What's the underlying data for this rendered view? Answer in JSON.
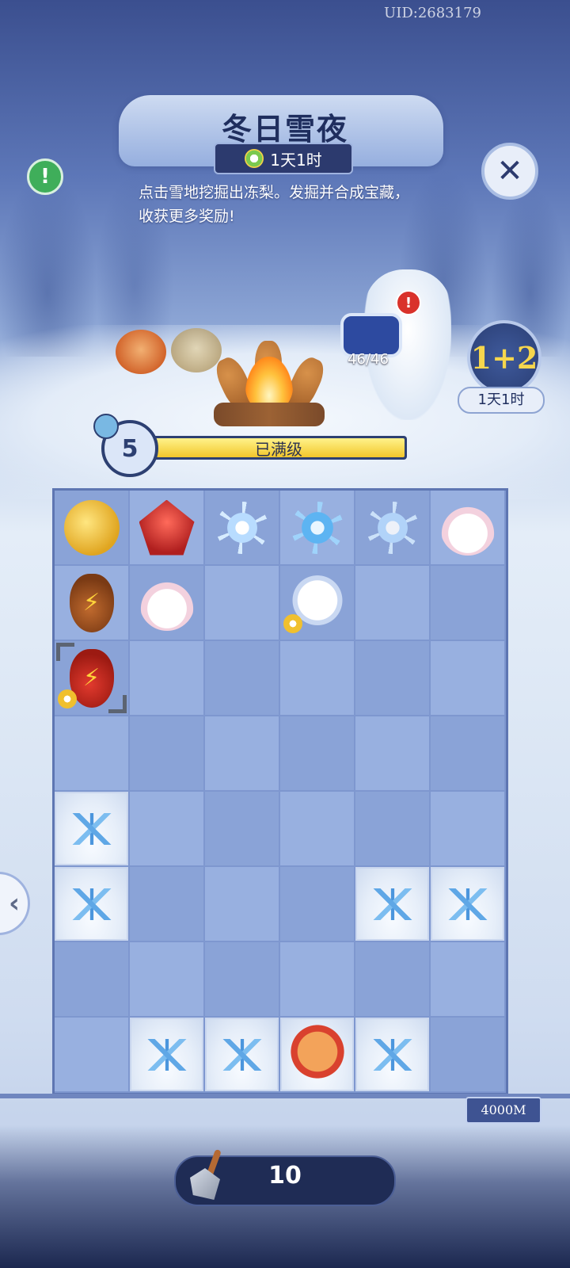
{
  "header": {
    "uid": "UID:2683179",
    "title": "冬日雪夜",
    "timer": "1天1时",
    "description": "点击雪地挖掘出冻梨。发掘并合成宝藏，收获更多奖励!"
  },
  "buttons": {
    "info": "!",
    "close": "✕",
    "alert": "!",
    "side_arrow": "‹"
  },
  "collection": {
    "count": "46/46"
  },
  "event_badge": {
    "label": "1+2",
    "time": "1天1时"
  },
  "level": {
    "number": "5",
    "status": "已满级"
  },
  "board": {
    "rows": 8,
    "cols": 6,
    "cells": [
      [
        "coins",
        "rubies",
        "snowflake-white",
        "snowflake-blue",
        "snowflake-pale",
        "peach-spirit"
      ],
      [
        "brown-gourd",
        "lotus-rabbit",
        "empty",
        "white-fox",
        "empty",
        "empty"
      ],
      [
        "red-gourd",
        "empty",
        "empty",
        "empty",
        "empty",
        "empty"
      ],
      [
        "empty",
        "empty",
        "empty",
        "empty",
        "empty",
        "empty"
      ],
      [
        "snow",
        "empty",
        "empty",
        "empty",
        "empty",
        "empty"
      ],
      [
        "snow",
        "empty",
        "empty",
        "empty",
        "snow",
        "snow"
      ],
      [
        "empty",
        "empty",
        "empty",
        "empty",
        "empty",
        "empty"
      ],
      [
        "empty",
        "snow",
        "snow",
        "snow-cat",
        "snow",
        "empty"
      ]
    ],
    "selected": [
      2,
      0
    ]
  },
  "depth": "4000M",
  "shovel": {
    "count": "10"
  }
}
